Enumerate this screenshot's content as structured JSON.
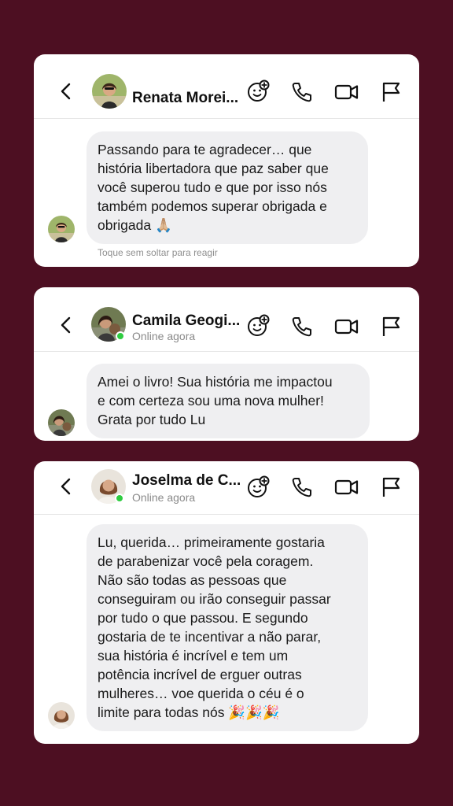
{
  "colors": {
    "background": "#4d0f22",
    "card": "#ffffff",
    "bubble": "#efeff1",
    "online": "#2ecc40"
  },
  "conversations": [
    {
      "contact_name": "Renata Morei...",
      "status": "",
      "message_lines": [
        "Passando para te agradecer… que",
        "história libertadora que paz saber que",
        "você superou tudo e que por isso nós",
        "também podemos superar obrigada e",
        "obrigada 🙏🏼"
      ],
      "hint": "Toque sem soltar para reagir",
      "icons": [
        "back-icon",
        "add-emoji-icon",
        "phone-icon",
        "video-icon",
        "flag-icon"
      ]
    },
    {
      "contact_name": "Camila Geogi...",
      "status": "Online agora",
      "message_lines": [
        "Amei o livro! Sua história me impactou",
        "e com certeza sou uma nova mulher!",
        "Grata por tudo Lu"
      ],
      "hint": "",
      "icons": [
        "back-icon",
        "add-emoji-icon",
        "phone-icon",
        "video-icon",
        "flag-icon"
      ]
    },
    {
      "contact_name": "Joselma de C...",
      "status": "Online agora",
      "message_lines": [
        "Lu, querida… primeiramente gostaria",
        "de parabenizar você pela coragem.",
        "Não são todas as pessoas que",
        "conseguiram ou irão conseguir passar",
        "por tudo o que passou. E segundo",
        "gostaria de te incentivar a não parar,",
        "sua história é incrível e tem um",
        "potência incrível de erguer outras",
        "mulheres… voe querida o céu é o",
        "limite para todas nós 🎉🎉🎉"
      ],
      "hint": "",
      "icons": [
        "back-icon",
        "add-emoji-icon",
        "phone-icon",
        "video-icon",
        "flag-icon"
      ]
    }
  ]
}
